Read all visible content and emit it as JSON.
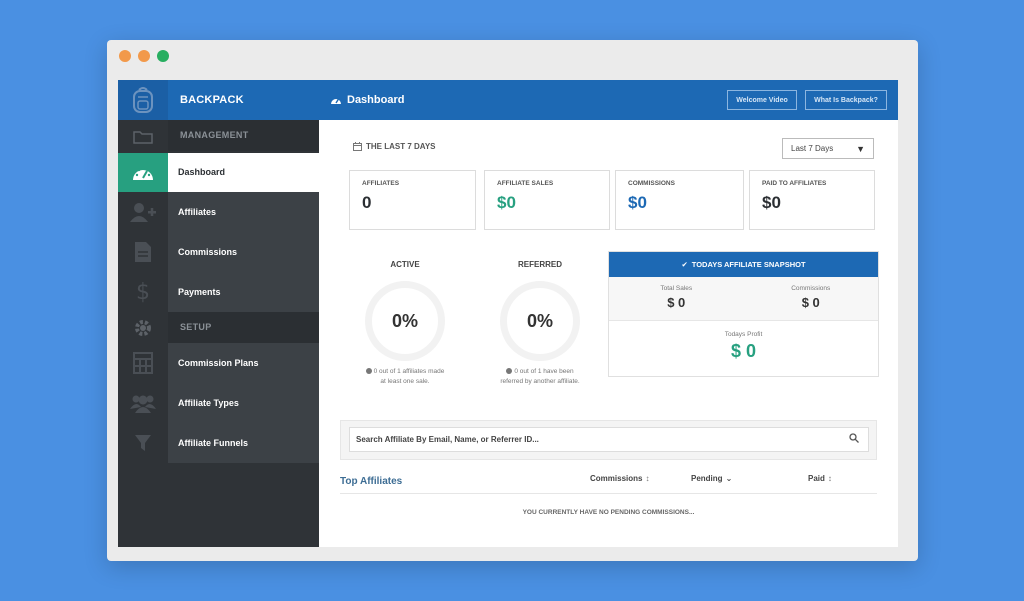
{
  "window": {
    "dots": [
      "#f2994a",
      "#f2994a",
      "#27ae60"
    ]
  },
  "brand": {
    "name": "BACKPACK"
  },
  "header": {
    "page_title": "Dashboard",
    "buttons": [
      "Welcome Video",
      "What Is Backpack?"
    ]
  },
  "sidebar": {
    "sections": {
      "management": "MANAGEMENT",
      "setup": "SETUP"
    },
    "items": [
      {
        "label": "Dashboard",
        "icon": "dashboard-gauge-icon",
        "active": true
      },
      {
        "label": "Affiliates",
        "icon": "add-user-icon"
      },
      {
        "label": "Commissions",
        "icon": "document-icon"
      },
      {
        "label": "Payments",
        "icon": "dollar-icon"
      },
      {
        "label": "Commission Plans",
        "icon": "calculator-icon"
      },
      {
        "label": "Affiliate Types",
        "icon": "users-group-icon"
      },
      {
        "label": "Affiliate Funnels",
        "icon": "funnel-icon"
      }
    ]
  },
  "main": {
    "period_label": "THE LAST 7 DAYS",
    "period_select": "Last 7 Days",
    "stats": [
      {
        "label": "AFFILIATES",
        "value": "0",
        "color": "#2b2f33"
      },
      {
        "label": "AFFILIATE SALES",
        "value": "$0",
        "color": "#27a080"
      },
      {
        "label": "COMMISSIONS",
        "value": "$0",
        "color": "#1d69b4"
      },
      {
        "label": "PAID TO AFFILIATES",
        "value": "$0",
        "color": "#2b2f33"
      }
    ],
    "gauges": [
      {
        "title": "ACTIVE",
        "value": "0%",
        "note": "0 out of 1 affiliates made at least one sale."
      },
      {
        "title": "REFERRED",
        "value": "0%",
        "note": "0 out of 1 have been referred by another affiliate."
      }
    ],
    "snapshot": {
      "title": "TODAYS AFFILIATE SNAPSHOT",
      "total_sales_label": "Total Sales",
      "total_sales_value": "$ 0",
      "commissions_label": "Commissions",
      "commissions_value": "$ 0",
      "profit_label": "Todays Profit",
      "profit_value": "$ 0"
    },
    "search": {
      "placeholder": "Search Affiliate By Email, Name, or Referrer ID..."
    },
    "table": {
      "title": "Top Affiliates",
      "columns": [
        "Commissions",
        "Pending",
        "Paid"
      ],
      "empty": "YOU CURRENTLY HAVE NO PENDING COMMISSIONS..."
    }
  }
}
